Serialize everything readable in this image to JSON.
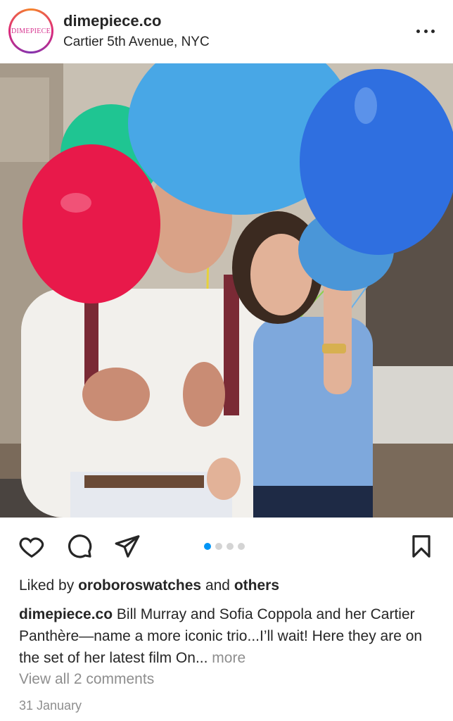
{
  "post": {
    "avatar_logo": "DIMEPIECE",
    "username": "dimepiece.co",
    "location": "Cartier 5th Avenue, NYC",
    "more_icon": "more-dots-icon"
  },
  "photo": {
    "description_colors": {
      "red_balloon": "#e8194a",
      "green_balloon": "#1fc592",
      "light_blue_balloon": "#48a7e6",
      "blue_balloon": "#2f6fe0"
    }
  },
  "actions": {
    "like_icon": "heart-icon",
    "comment_icon": "comment-icon",
    "share_icon": "paper-plane-icon",
    "save_icon": "bookmark-icon",
    "carousel": {
      "total": 4,
      "active_index": 0
    }
  },
  "likes": {
    "prefix": "Liked by",
    "user": "oroboroswatches",
    "conjunction": "and",
    "others": "others"
  },
  "caption": {
    "username": "dimepiece.co",
    "text": "Bill Murray and Sofia Coppola and her Cartier Panthère—name a more iconic trio...I’ll wait! Here they are on the set of her latest film On...",
    "more_label": "more"
  },
  "comments_link": "View all 2 comments",
  "date": "31 January",
  "colors": {
    "accent": "#0095f6",
    "text": "#262626",
    "muted": "#8e8e8e"
  }
}
